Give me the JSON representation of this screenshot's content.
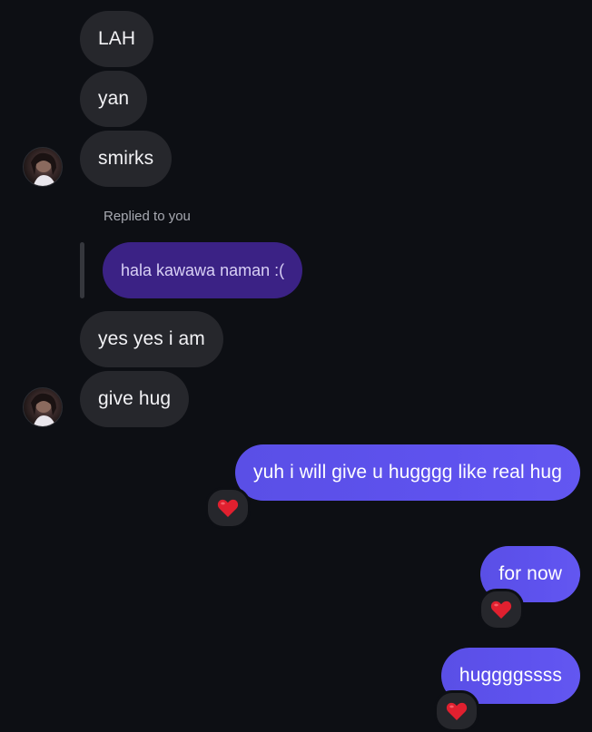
{
  "messages": {
    "m1": "LAH",
    "m2": "yan",
    "m3": "smirks",
    "reply_label": "Replied to you",
    "reply_quote": "hala kawawa naman :(",
    "m4": "yes yes i am",
    "m5": "give hug",
    "s1": "yuh i will give u hugggg like real hug",
    "s2": "for now",
    "s3": "huggggssss"
  },
  "reactions": {
    "s1": "heart-icon",
    "s2": "heart-icon",
    "s3": "heart-icon"
  },
  "colors": {
    "background": "#0d0f14",
    "received_bubble": "#26272c",
    "sent_bubble": "#5e52ee",
    "reply_bubble": "#3b2285",
    "heart": "#e0202f"
  }
}
